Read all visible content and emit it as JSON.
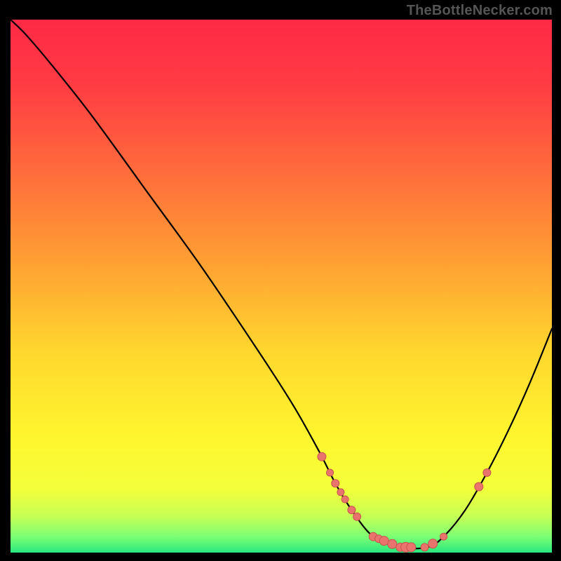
{
  "watermark": "TheBottleNecker.com",
  "colors": {
    "curve": "#000000",
    "marker_fill": "#e9736d",
    "marker_stroke": "#c9534d",
    "gradient_stops": [
      {
        "offset": "0%",
        "color": "#ff2a46"
      },
      {
        "offset": "12%",
        "color": "#ff3b44"
      },
      {
        "offset": "28%",
        "color": "#ff6a3c"
      },
      {
        "offset": "45%",
        "color": "#ff9e33"
      },
      {
        "offset": "62%",
        "color": "#ffd62e"
      },
      {
        "offset": "78%",
        "color": "#fff52e"
      },
      {
        "offset": "88%",
        "color": "#f3ff3a"
      },
      {
        "offset": "93%",
        "color": "#c9ff54"
      },
      {
        "offset": "97%",
        "color": "#7dff74"
      },
      {
        "offset": "100%",
        "color": "#28e87f"
      }
    ]
  },
  "chart_data": {
    "type": "line",
    "title": "",
    "xlabel": "",
    "ylabel": "",
    "xlim": [
      0,
      100
    ],
    "ylim": [
      0,
      100
    ],
    "x": [
      0,
      3,
      8,
      15,
      25,
      35,
      45,
      52,
      57,
      60,
      63,
      67,
      72,
      77,
      80,
      84,
      88,
      92,
      96,
      100
    ],
    "values": [
      100,
      97,
      91,
      82,
      68,
      54,
      39,
      28,
      19,
      13,
      8,
      3,
      1,
      1,
      3,
      8,
      15,
      23,
      32,
      42
    ],
    "markers_x": [
      57.5,
      59,
      60,
      61,
      61.8,
      63,
      64,
      67,
      68,
      69,
      70.5,
      72,
      73,
      74,
      76.5,
      78,
      80,
      86.5,
      88
    ],
    "markers_r": [
      6,
      5,
      5.5,
      5,
      5,
      5.5,
      5.5,
      6,
      5.5,
      6.5,
      6.5,
      6,
      7,
      6.5,
      5.5,
      6.5,
      5,
      6,
      5.5
    ]
  }
}
